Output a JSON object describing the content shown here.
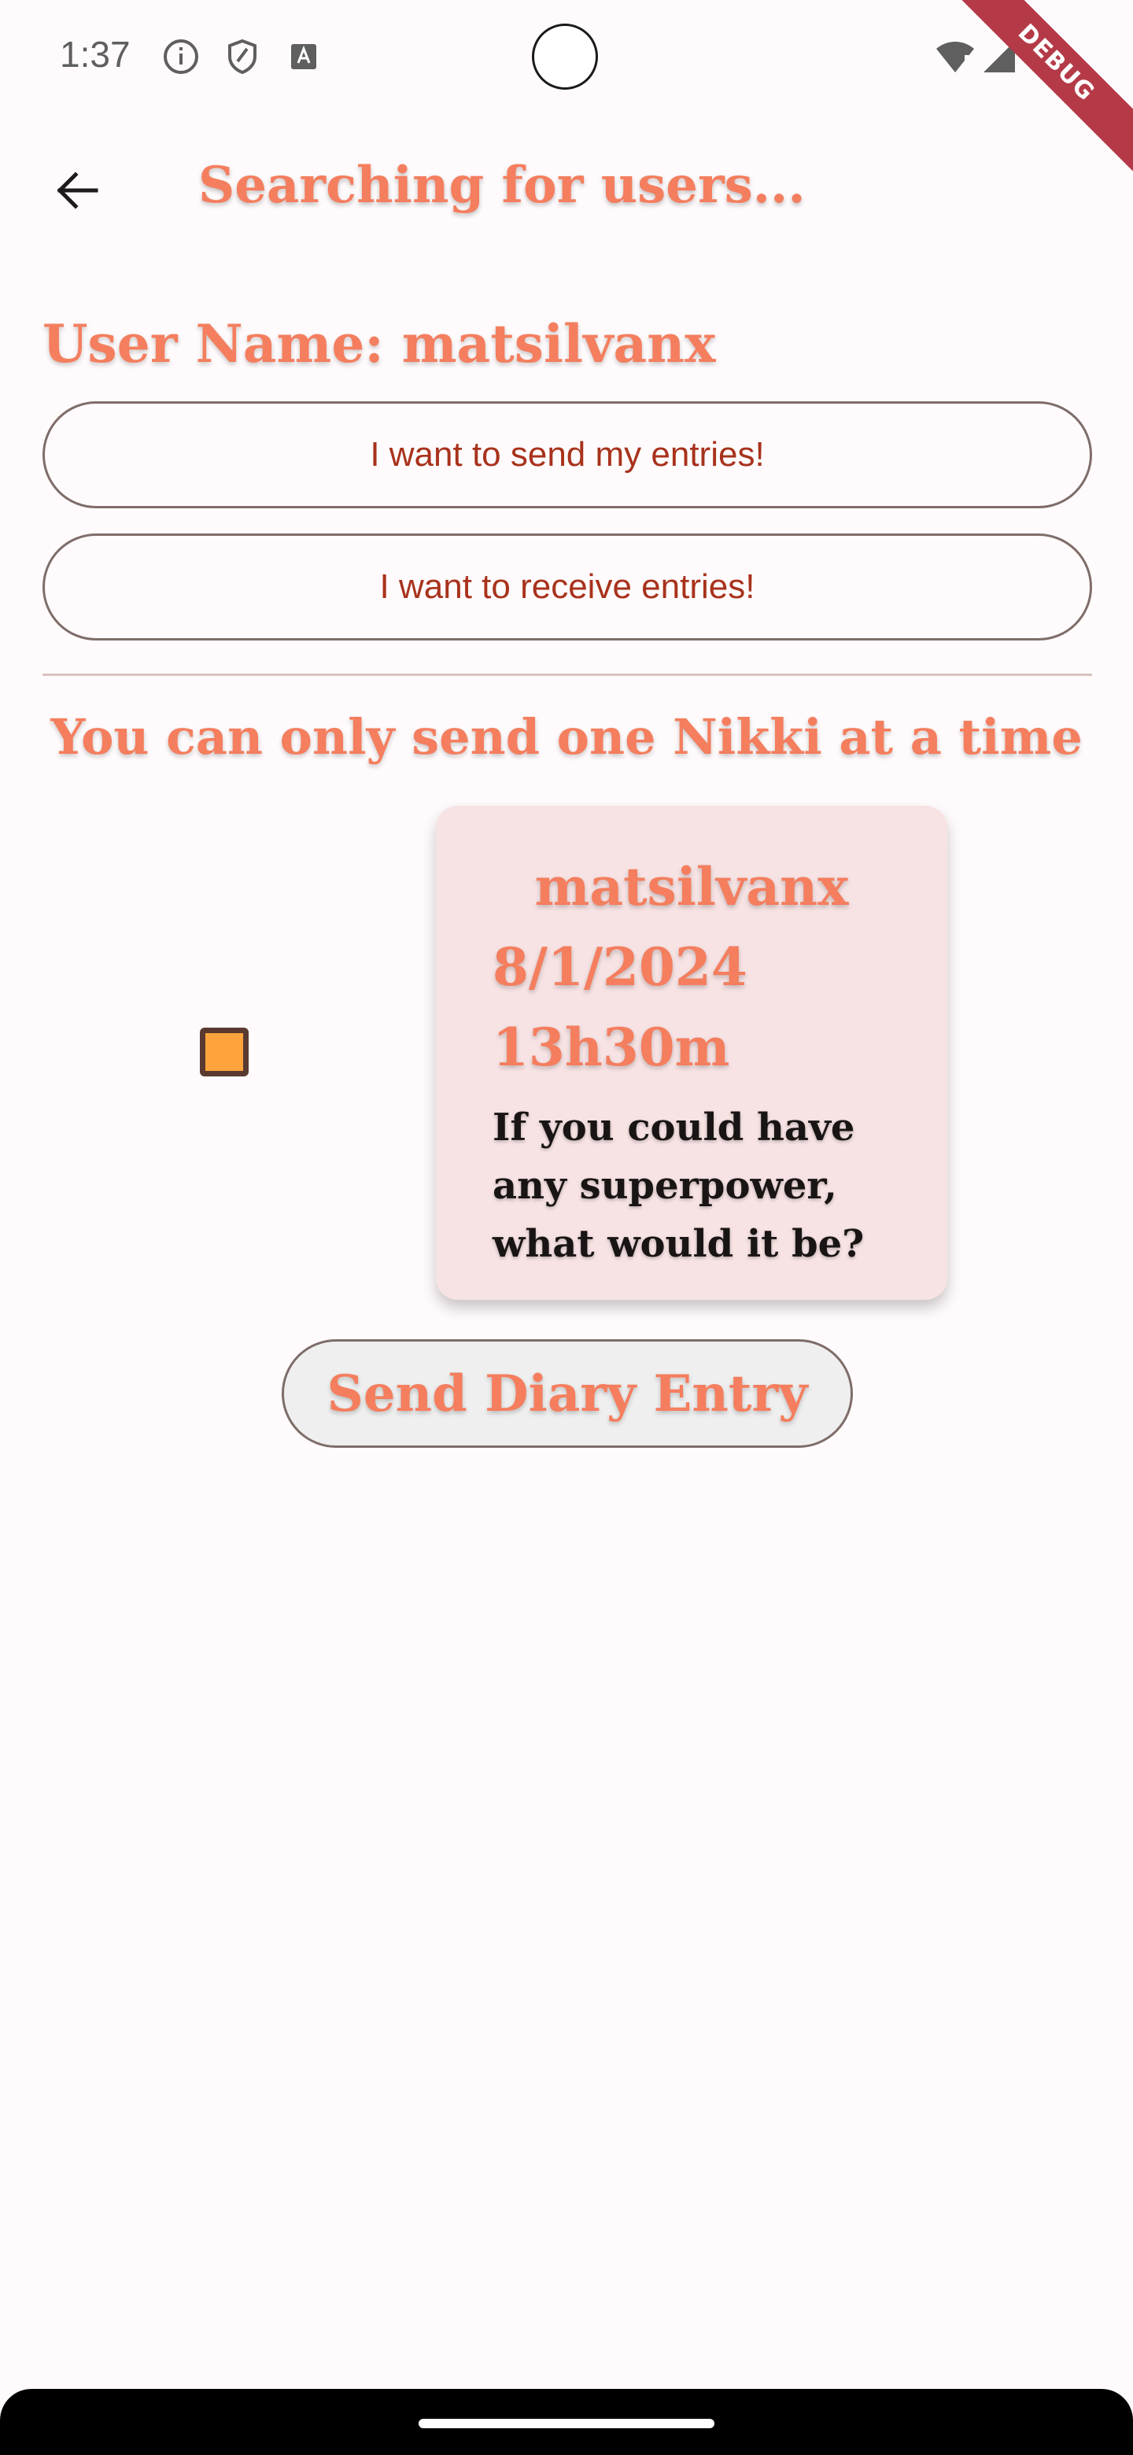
{
  "status_bar": {
    "time": "1:37",
    "debug_label": "DEBUG",
    "icons": [
      "info-icon",
      "shield-icon",
      "text-a-icon",
      "wifi-icon",
      "signal-icon"
    ]
  },
  "app_bar": {
    "back_icon": "arrow-back-icon",
    "title": "Searching for users..."
  },
  "user": {
    "label": "User Name: matsilvanx"
  },
  "buttons": {
    "send_entries": "I want to send my entries!",
    "receive_entries": "I want to receive entries!",
    "send_diary_entry": "Send Diary Entry"
  },
  "info": {
    "message": "You can only send one Nikki at a time"
  },
  "entry": {
    "selected": true,
    "author": "matsilvanx",
    "date": "8/1/2024",
    "time": "13h30m",
    "question": "If you could have any superpower, what would it be?"
  },
  "colors": {
    "accent": "#f47e5e",
    "button_text": "#a8321c",
    "card_background": "#f7e3e4",
    "checkbox_fill": "#ffa43c",
    "background": "#fffbfc"
  }
}
